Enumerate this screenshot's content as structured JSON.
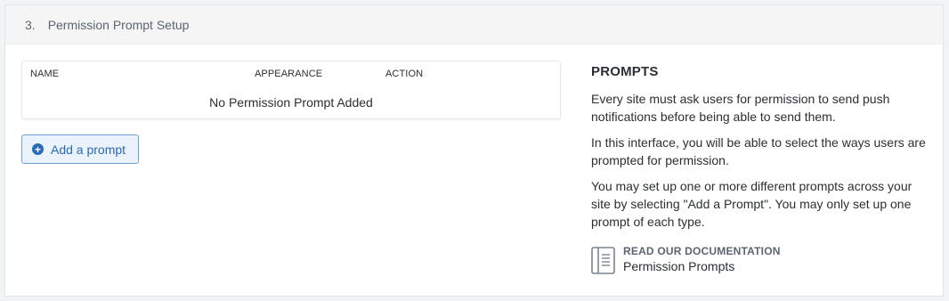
{
  "section": {
    "number": "3.",
    "title": "Permission Prompt Setup"
  },
  "table": {
    "columns": [
      "NAME",
      "APPEARANCE",
      "ACTION"
    ],
    "empty_message": "No Permission Prompt Added"
  },
  "add_button": {
    "icon": "plus-circle-icon",
    "label": "Add a prompt"
  },
  "info": {
    "heading": "PROMPTS",
    "paragraphs": [
      "Every site must ask users for permission to send push notifications before being able to send them.",
      "In this interface, you will be able to select the ways users are prompted for permission.",
      "You may set up one or more different prompts across your site by selecting \"Add a Prompt\". You may only set up one prompt of each type."
    ],
    "doc_link": {
      "icon": "documentation-book-icon",
      "label": "READ OUR DOCUMENTATION",
      "title": "Permission Prompts"
    }
  },
  "colors": {
    "accent": "#2a6ab6",
    "button_bg": "#eaf2fb",
    "header_bg": "#f4f5f4"
  }
}
